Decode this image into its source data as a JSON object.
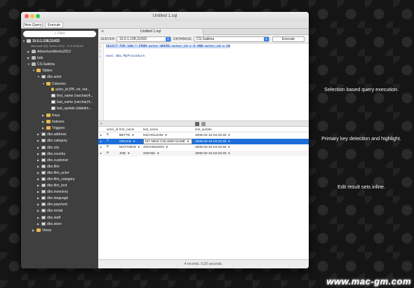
{
  "window": {
    "title": "Untitled 1.sql"
  },
  "toolbar": {
    "new_query_label": "New Query",
    "execute_label": "Execute"
  },
  "sidebar": {
    "filter_placeholder": "Filter",
    "server": {
      "name": "10.0.1.108,31433",
      "version": "Microsoft SQL Server 2012 - 11.0.2100.60"
    },
    "nodes": [
      {
        "label": "AdventureWorks2012",
        "icon": "database-icon",
        "indent": 1,
        "expanded": false
      },
      {
        "label": "bob",
        "icon": "database-icon",
        "indent": 1,
        "expanded": false
      },
      {
        "label": "CS-Saklina",
        "icon": "database-icon",
        "indent": 1,
        "expanded": true
      },
      {
        "label": "Tables",
        "icon": "folder-icon",
        "indent": 2,
        "expanded": true
      },
      {
        "label": "dbo.actor",
        "icon": "table-icon",
        "indent": 3,
        "expanded": true
      },
      {
        "label": "Columns",
        "icon": "folder-icon",
        "indent": 4,
        "expanded": true
      },
      {
        "label": "actor_id (PK, int, not...",
        "icon": "key-icon",
        "indent": 5,
        "expanded": null
      },
      {
        "label": "first_name (varchar(4...",
        "icon": "column-icon",
        "indent": 5,
        "expanded": null
      },
      {
        "label": "last_name (varchar(4...",
        "icon": "column-icon",
        "indent": 5,
        "expanded": null
      },
      {
        "label": "last_update (datetim...",
        "icon": "column-icon",
        "indent": 5,
        "expanded": null
      },
      {
        "label": "Keys",
        "icon": "folder-icon",
        "indent": 4,
        "expanded": false
      },
      {
        "label": "Indexes",
        "icon": "folder-icon",
        "indent": 4,
        "expanded": false
      },
      {
        "label": "Triggers",
        "icon": "folder-icon",
        "indent": 4,
        "expanded": false
      },
      {
        "label": "dbo.address",
        "icon": "table-icon",
        "indent": 3,
        "expanded": false
      },
      {
        "label": "dbo.category",
        "icon": "table-icon",
        "indent": 3,
        "expanded": false
      },
      {
        "label": "dbo.city",
        "icon": "table-icon",
        "indent": 3,
        "expanded": false
      },
      {
        "label": "dbo.country",
        "icon": "table-icon",
        "indent": 3,
        "expanded": false
      },
      {
        "label": "dbo.customer",
        "icon": "table-icon",
        "indent": 3,
        "expanded": false
      },
      {
        "label": "dbo.film",
        "icon": "table-icon",
        "indent": 3,
        "expanded": false
      },
      {
        "label": "dbo.film_actor",
        "icon": "table-icon",
        "indent": 3,
        "expanded": false
      },
      {
        "label": "dbo.film_category",
        "icon": "table-icon",
        "indent": 3,
        "expanded": false
      },
      {
        "label": "dbo.film_text",
        "icon": "table-icon",
        "indent": 3,
        "expanded": false
      },
      {
        "label": "dbo.inventory",
        "icon": "table-icon",
        "indent": 3,
        "expanded": false
      },
      {
        "label": "dbo.language",
        "icon": "table-icon",
        "indent": 3,
        "expanded": false
      },
      {
        "label": "dbo.payment",
        "icon": "table-icon",
        "indent": 3,
        "expanded": false
      },
      {
        "label": "dbo.rental",
        "icon": "table-icon",
        "indent": 3,
        "expanded": false
      },
      {
        "label": "dbo.staff",
        "icon": "table-icon",
        "indent": 3,
        "expanded": false
      },
      {
        "label": "dbo.store",
        "icon": "table-icon",
        "indent": 3,
        "expanded": false
      },
      {
        "label": "Views",
        "icon": "folder-icon",
        "indent": 2,
        "expanded": false
      }
    ]
  },
  "tab": {
    "label": "Untitled 1.sql"
  },
  "connection": {
    "server_label": "SERVER:",
    "server_value": "10.0.1.108,31433",
    "database_label": "DATABASE:",
    "database_value": "CS-Saklina",
    "execute_label": "Execute"
  },
  "editor": {
    "lines": [
      {
        "num": "1",
        "text": "SELECT TOP 100 * FROM actor WHERE actor_id > 5 AND actor_id < 10",
        "highlighted": true
      },
      {
        "num": "2",
        "text": "",
        "highlighted": false
      },
      {
        "num": "3",
        "text": "exec dbo.MyProcedure",
        "highlighted": false
      }
    ]
  },
  "results": {
    "columns": [
      "actor_id",
      "first_name",
      "last_name",
      "last_update"
    ],
    "rows": [
      {
        "actor_id": "6",
        "first_name": "BETTE",
        "last_name": "NICHOLSON",
        "last_update": "2006-02-15 04:34:33",
        "state": "normal"
      },
      {
        "actor_id": "7",
        "first_name": "GRACE",
        "last_name": "MY NEW COLUMN NAME",
        "last_update": "2006-02-15 04:34:33",
        "state": "selected"
      },
      {
        "actor_id": "8",
        "first_name": "MATTHEW",
        "last_name": "JOHANSSON",
        "last_update": "2006-02-15 04:34:33",
        "state": "normal"
      },
      {
        "actor_id": "9",
        "first_name": "JOE",
        "last_name": "SWANK",
        "last_update": "2006-02-15 04:34:33",
        "state": "normal"
      }
    ]
  },
  "status": {
    "text": "4 records. 0.29 seconds."
  },
  "features": [
    "Selection based query execution.",
    "Primary key detection and highlight.",
    "Edit result sets inline."
  ],
  "watermark": "www.mac-gm.com",
  "colors": {
    "selection": "#1e6fd9",
    "sidebar_bg": "#3f3f3f",
    "keyword": "#1a3a99",
    "dropdown_accent": "#3b82f6"
  }
}
